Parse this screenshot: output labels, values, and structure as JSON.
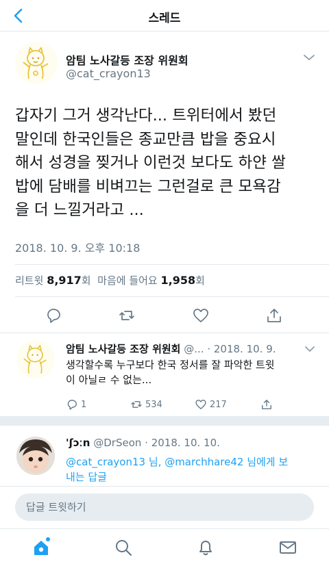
{
  "header": {
    "title": "스레드"
  },
  "main_tweet": {
    "name": "암팀 노사갈등 조장 위원회",
    "handle": "@cat_crayon13",
    "text_lines": [
      "갑자기 그거 생각난다... 트위터에서 봤던",
      "말인데 한국인들은 종교만큼 밥을 중요시",
      "해서 성경을 찢거나 이런것 보다도 하얀 쌀",
      "밥에 담배를 비벼끄는 그런걸로 큰 모욕감",
      "을 더 느낄거라고 ..."
    ],
    "date": "2018. 10. 9. 오후 10:18",
    "retweets_label": "리트윗",
    "retweets_count": "8,917",
    "retweets_unit": "회",
    "likes_label": "마음에 들어요",
    "likes_count": "1,958",
    "likes_unit": "회"
  },
  "reply1": {
    "name": "암팀 노사갈등 조장 위원회",
    "handle_date": "@... · 2018. 10. 9.",
    "text_lines": [
      "생각할수록 누구보다 한국 정서를 잘 파악한 트윗",
      "이 아닐ㄹ 수 없는..."
    ],
    "reply_count": "1",
    "retweet_count": "534",
    "like_count": "217"
  },
  "reply2": {
    "name": "'ʃɔːn",
    "handle_date": "@DrSeon · 2018. 10. 10.",
    "mention1": "@cat_crayon13",
    "connector1": " 님, ",
    "mention2": "@marchhare42",
    "connector2": " 님에게 보",
    "line2": "내는 답글"
  },
  "compose": {
    "placeholder": "답글 트윗하기"
  },
  "colors": {
    "accent": "#1da1f2",
    "muted": "#657786",
    "divider": "#e1e8ed"
  },
  "tabbar": {
    "items": [
      "home-icon",
      "search-icon",
      "bell-icon",
      "mail-icon"
    ]
  }
}
